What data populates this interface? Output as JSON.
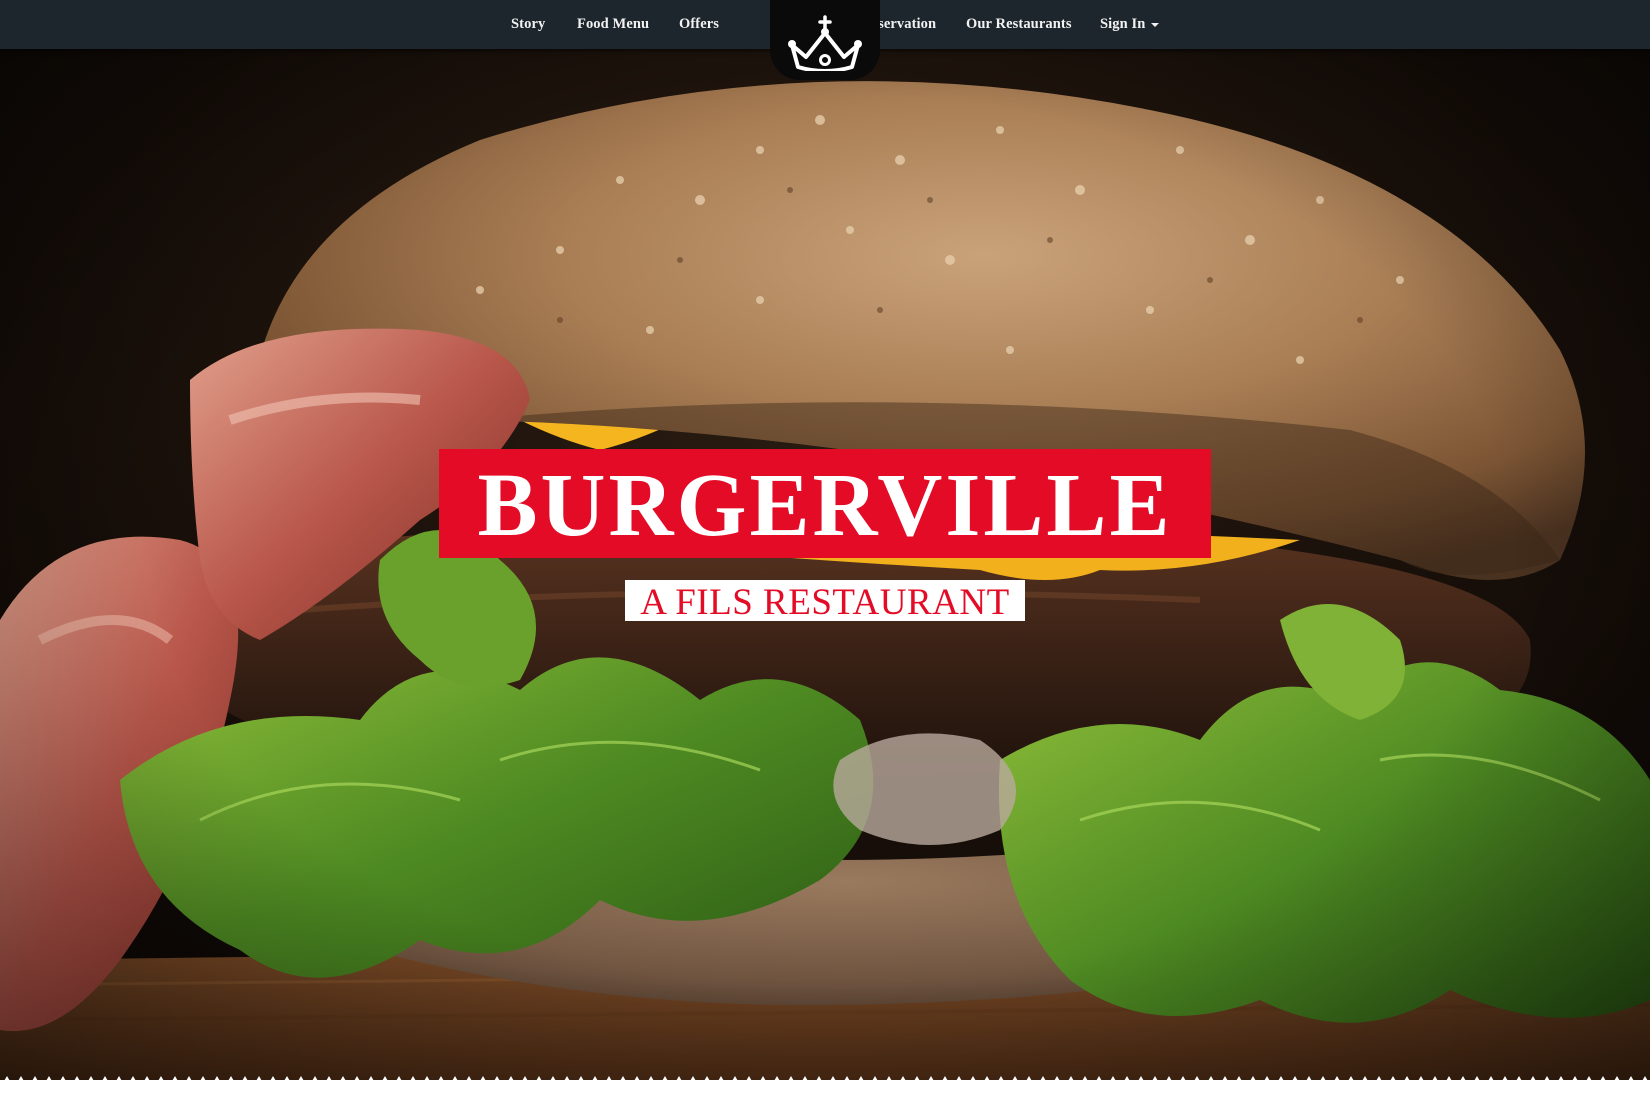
{
  "nav": {
    "left_items": [
      {
        "label": "Story"
      },
      {
        "label": "Food Menu"
      },
      {
        "label": "Offers"
      }
    ],
    "right_items": [
      {
        "label": "Reservation"
      },
      {
        "label": "Our Restaurants"
      },
      {
        "label": "Sign In"
      }
    ],
    "logo_icon": "crown-icon"
  },
  "hero": {
    "title": "BURGERVILLE",
    "subtitle": "A FILS RESTAURANT",
    "image": "burger-photo"
  },
  "colors": {
    "navbar_bg": "#1e262d",
    "accent_red": "#e30b26",
    "nav_text": "#f2f2f2",
    "subtitle_bg": "#ffffff"
  }
}
